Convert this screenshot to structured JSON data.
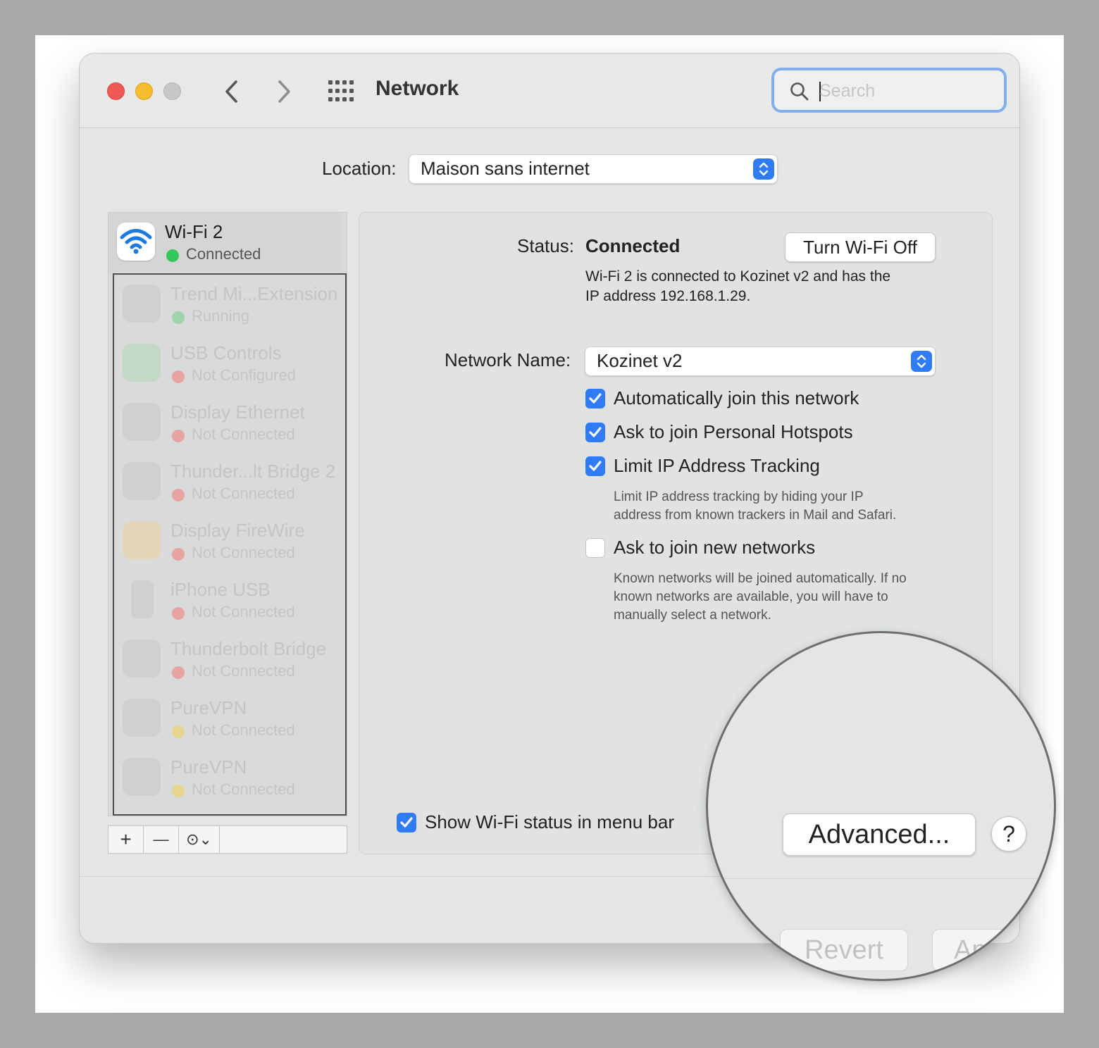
{
  "window": {
    "title": "Network",
    "search": {
      "placeholder": "Search",
      "value": ""
    }
  },
  "location": {
    "label": "Location:",
    "value": "Maison sans internet"
  },
  "sidebar": {
    "selected": {
      "name": "Wi-Fi 2",
      "status": "Connected",
      "status_color": "#34c759",
      "icon": "wifi-icon"
    },
    "items": [
      {
        "name": "Trend Mi...Extension",
        "status": "Running",
        "status_color": "#34c759",
        "icon": "lock-icon"
      },
      {
        "name": "USB Controls",
        "status": "Not Configured",
        "status_color": "#ff3b30",
        "icon": "phone-icon"
      },
      {
        "name": "Display Ethernet",
        "status": "Not Connected",
        "status_color": "#ff3b30",
        "icon": "ethernet-icon"
      },
      {
        "name": "Thunder...lt Bridge 2",
        "status": "Not Connected",
        "status_color": "#ff3b30",
        "icon": "ethernet-icon"
      },
      {
        "name": "Display FireWire",
        "status": "Not Connected",
        "status_color": "#ff3b30",
        "icon": "firewire-icon"
      },
      {
        "name": "iPhone USB",
        "status": "Not Connected",
        "status_color": "#ff3b30",
        "icon": "iphone-icon"
      },
      {
        "name": "Thunderbolt Bridge",
        "status": "Not Connected",
        "status_color": "#ff3b30",
        "icon": "ethernet-icon"
      },
      {
        "name": "PureVPN",
        "status": "Not Connected",
        "status_color": "#ffcc00",
        "icon": "lock-icon"
      },
      {
        "name": "PureVPN",
        "status": "Not Connected",
        "status_color": "#ffcc00",
        "icon": "lock-icon"
      }
    ],
    "toolbar": {
      "add": "+",
      "remove": "—",
      "action": "⊙⌄"
    }
  },
  "detail": {
    "status_label": "Status:",
    "status_value": "Connected",
    "turn_off_button": "Turn Wi-Fi Off",
    "status_desc_line1": "Wi-Fi 2 is connected to Kozinet v2 and has the",
    "status_desc_line2": "IP address 192.168.1.29.",
    "network_name_label": "Network Name:",
    "network_name_value": "Kozinet v2",
    "checkboxes": {
      "auto_join": {
        "label": "Automatically join this network",
        "checked": true
      },
      "hotspots": {
        "label": "Ask to join Personal Hotspots",
        "checked": true
      },
      "limit_ip": {
        "label": "Limit IP Address Tracking",
        "checked": true
      },
      "new_networks": {
        "label": "Ask to join new networks",
        "checked": false
      },
      "show_status": {
        "label": "Show Wi-Fi status in menu bar",
        "checked": true
      }
    },
    "limit_ip_desc_line1": "Limit IP address tracking by hiding your IP",
    "limit_ip_desc_line2": "address from known trackers in Mail and Safari.",
    "new_networks_desc_line1": "Known networks will be joined automatically. If no",
    "new_networks_desc_line2": "known networks are available, you will have to",
    "new_networks_desc_line3": "manually select a network."
  },
  "buttons": {
    "advanced": "Advanced...",
    "help": "?",
    "revert": "Revert",
    "apply": "Apply"
  },
  "colors": {
    "accent": "#2f7cf6",
    "search_focus_ring": "#82aef0"
  }
}
